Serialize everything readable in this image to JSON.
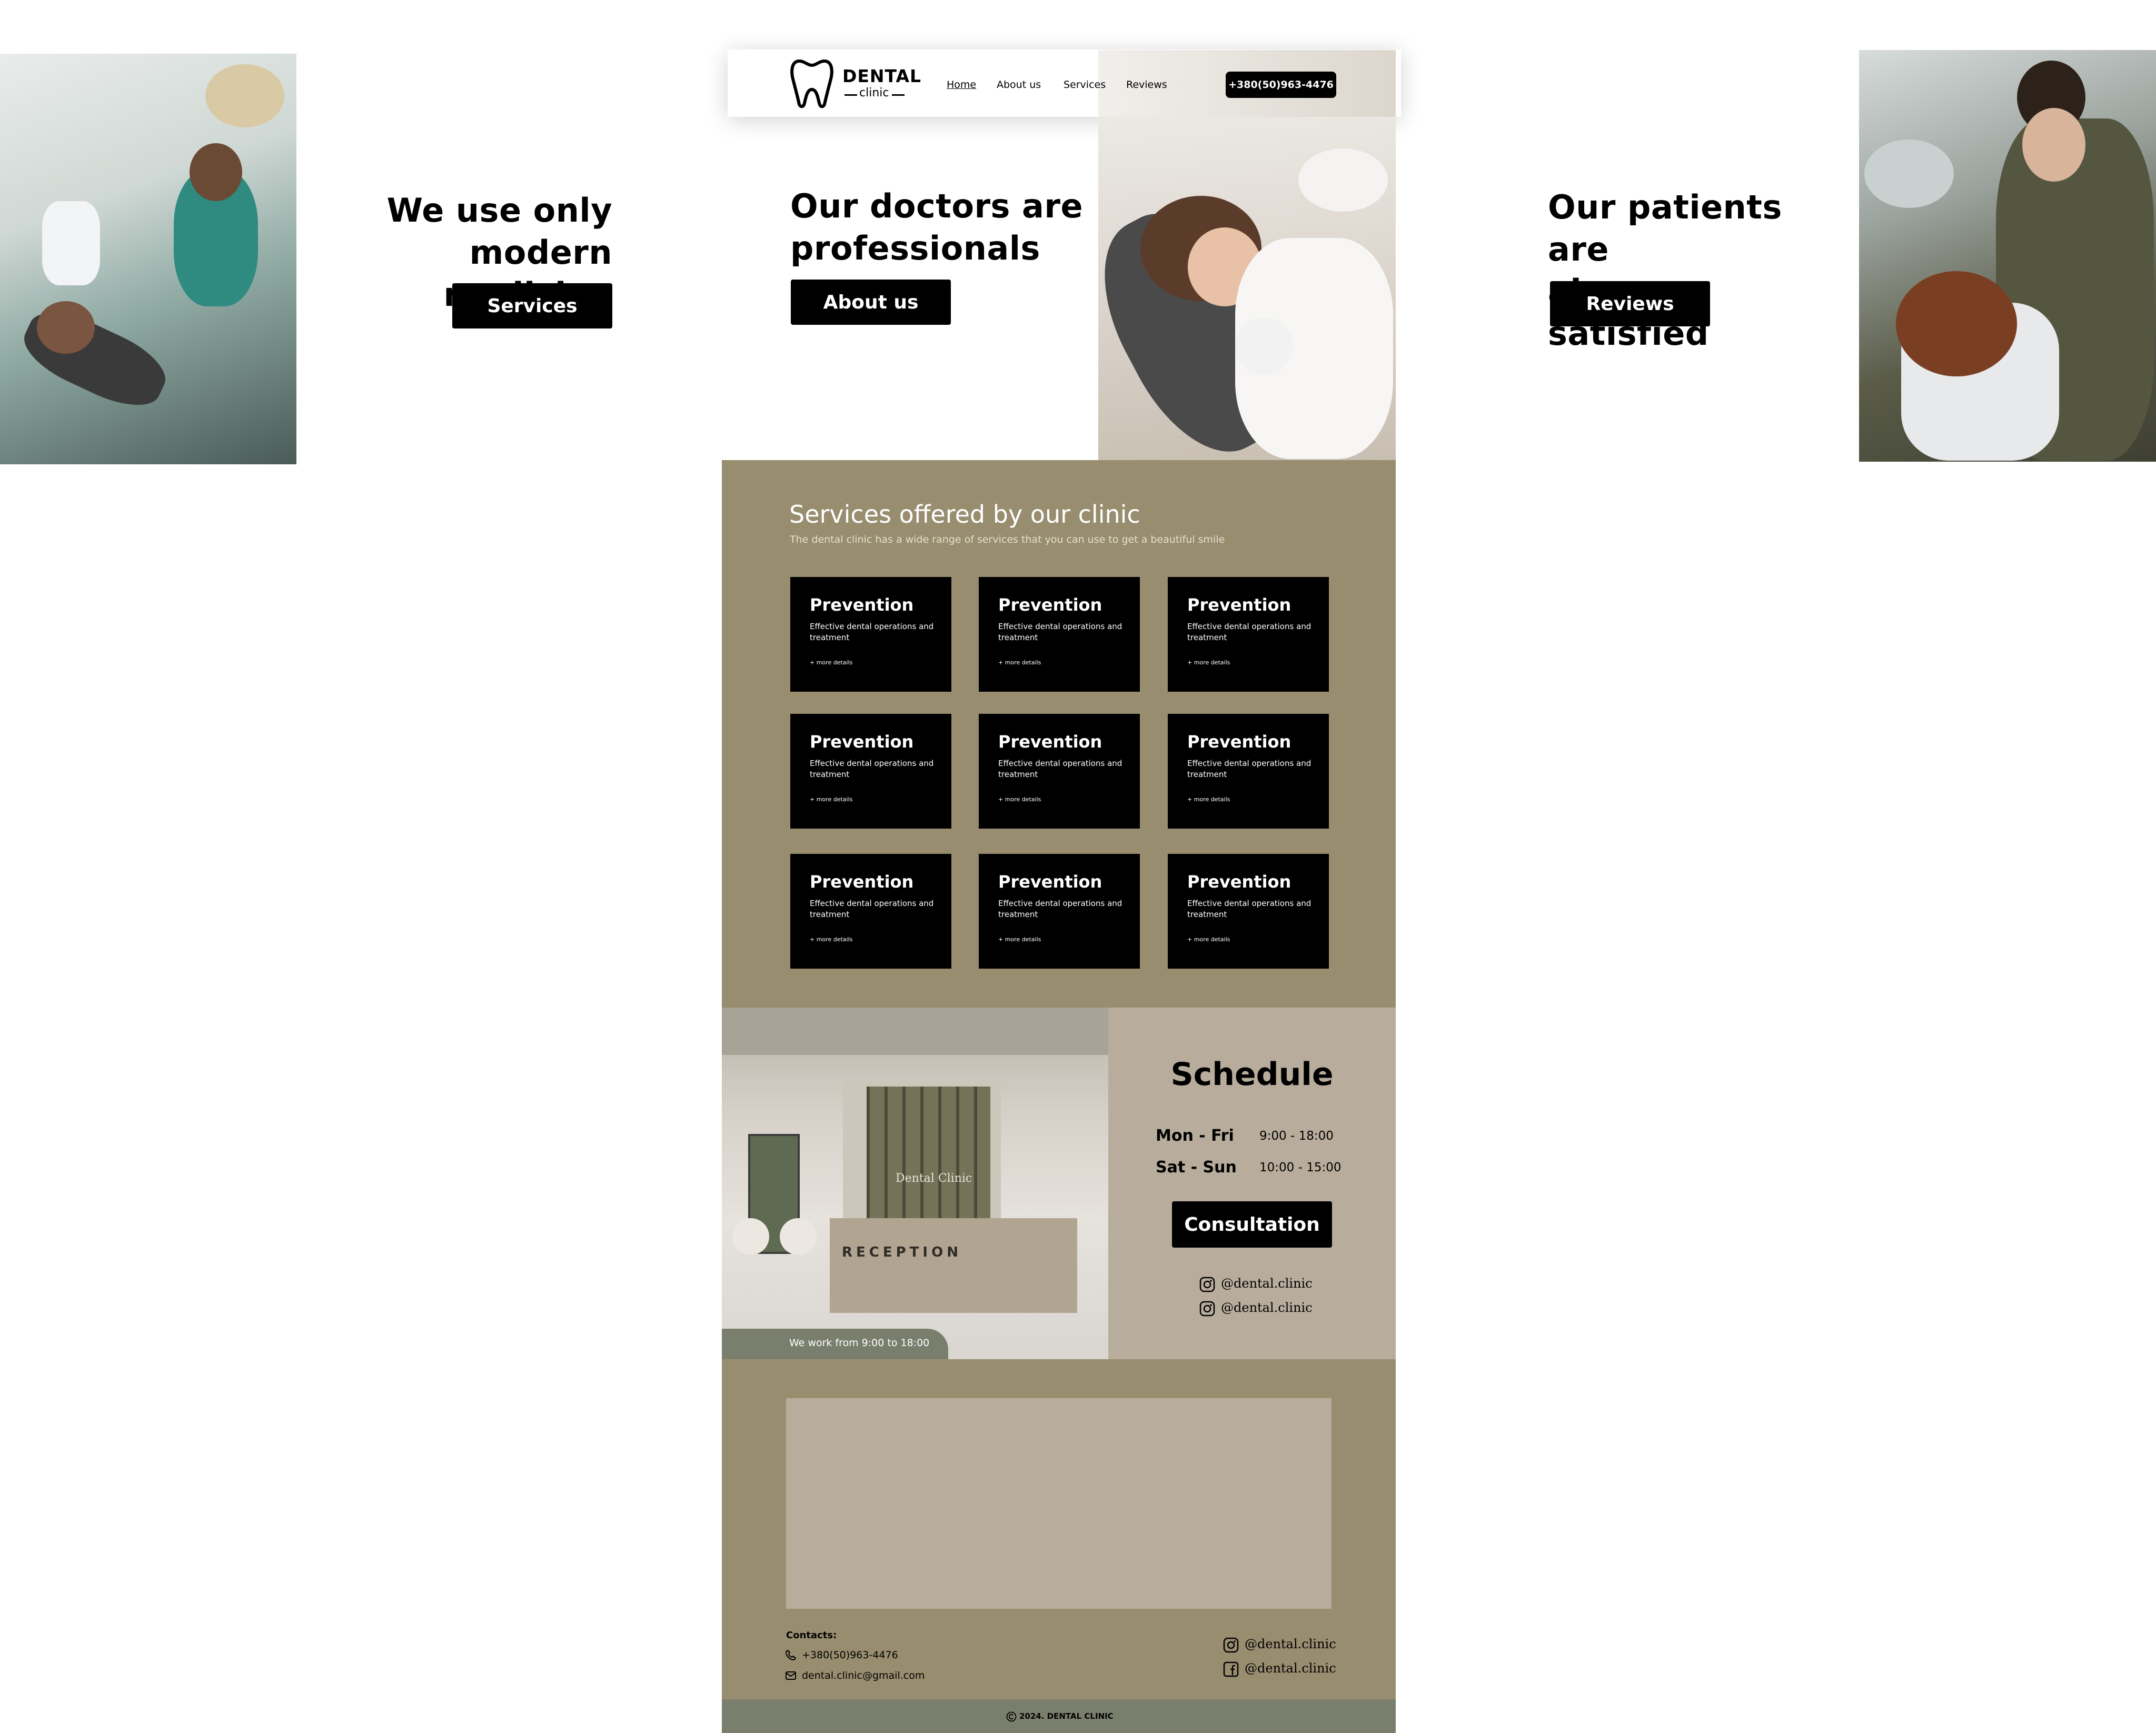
{
  "header": {
    "logo_main": "DENTAL",
    "logo_sub": "clinic",
    "nav": [
      "Home",
      "About us",
      "Services",
      "Reviews"
    ],
    "phone": "+380(50)963-4476"
  },
  "hero": {
    "left": {
      "line1": "We use only",
      "line2": "modern medicine",
      "button": "Services"
    },
    "center": {
      "line1": "Our doctors are",
      "line2": "professionals",
      "button": "About us"
    },
    "right": {
      "line1": "Our patients are",
      "line2": "always satisfied",
      "button": "Reviews"
    }
  },
  "services": {
    "title": "Services offered by our clinic",
    "subtitle": "The dental clinic has a wide range of services that you can use to get a beautiful smile",
    "cards": [
      {
        "title": "Prevention",
        "desc": "Effective dental operations and treatment",
        "more": "+ more details"
      },
      {
        "title": "Prevention",
        "desc": "Effective dental operations and treatment",
        "more": "+ more details"
      },
      {
        "title": "Prevention",
        "desc": "Effective dental operations and treatment",
        "more": "+ more details"
      },
      {
        "title": "Prevention",
        "desc": "Effective dental operations and treatment",
        "more": "+ more details"
      },
      {
        "title": "Prevention",
        "desc": "Effective dental operations and treatment",
        "more": "+ more details"
      },
      {
        "title": "Prevention",
        "desc": "Effective dental operations and treatment",
        "more": "+ more details"
      },
      {
        "title": "Prevention",
        "desc": "Effective dental operations and treatment",
        "more": "+ more details"
      },
      {
        "title": "Prevention",
        "desc": "Effective dental operations and treatment",
        "more": "+ more details"
      },
      {
        "title": "Prevention",
        "desc": "Effective dental operations and treatment",
        "more": "+ more details"
      }
    ]
  },
  "reception": {
    "photo_sign": "RECEPTION",
    "wall_logo": "Dental Clinic",
    "hours_tag": "We work from 9:00 to 18:00"
  },
  "schedule": {
    "title": "Schedule",
    "rows": [
      {
        "days": "Mon - Fri",
        "hours": "9:00 - 18:00"
      },
      {
        "days": "Sat - Sun",
        "hours": "10:00 - 15:00"
      }
    ],
    "button": "Consultation",
    "socials": [
      "@dental.clinic",
      "@dental.clinic"
    ]
  },
  "contacts": {
    "label": "Contacts:",
    "phone": "+380(50)963-4476",
    "email": "dental.clinic@gmail.com",
    "socials": [
      "@dental.clinic",
      "@dental.clinic"
    ]
  },
  "footer": {
    "copyright": "2024. DENTAL CLINIC"
  },
  "colors": {
    "olive": "#988d6f",
    "sand": "#b8ad9c",
    "footer": "#7a7f6d",
    "card": "#000000"
  }
}
